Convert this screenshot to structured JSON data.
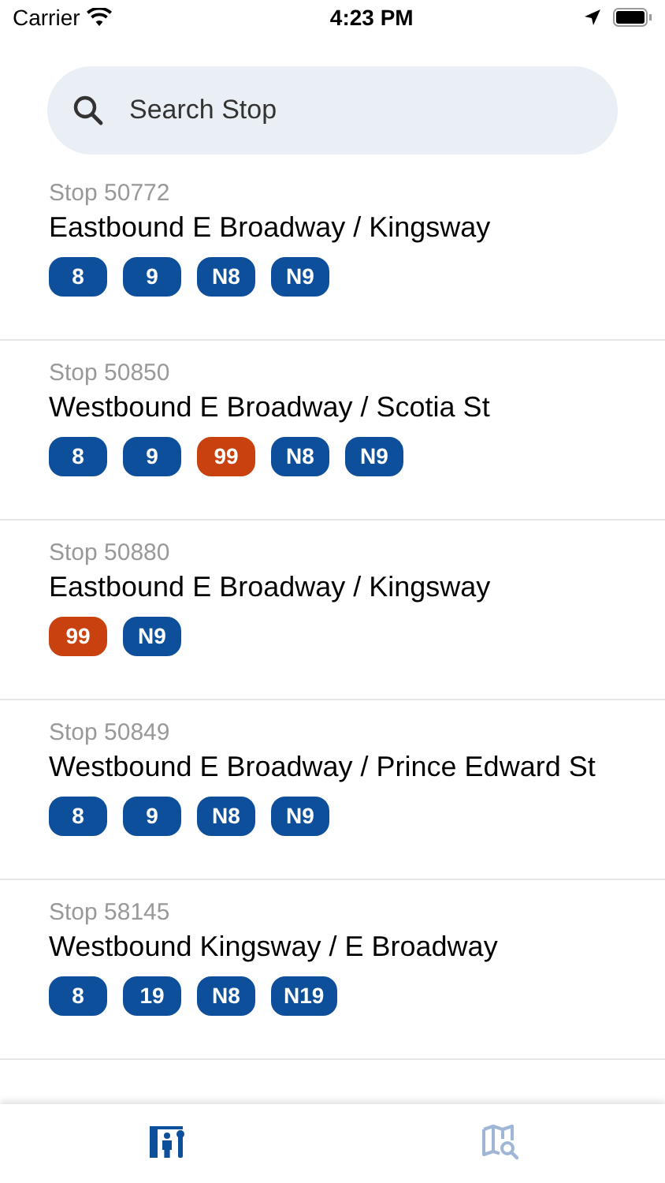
{
  "status_bar": {
    "carrier": "Carrier",
    "time": "4:23 PM"
  },
  "search": {
    "placeholder": "Search Stop"
  },
  "stops": [
    {
      "stop": "Stop 50772",
      "name": "Eastbound E Broadway / Kingsway",
      "routes": [
        {
          "label": "8",
          "color": "#0d4f9a"
        },
        {
          "label": "9",
          "color": "#0d4f9a"
        },
        {
          "label": "N8",
          "color": "#0d4f9a"
        },
        {
          "label": "N9",
          "color": "#0d4f9a"
        }
      ]
    },
    {
      "stop": "Stop 50850",
      "name": "Westbound E Broadway / Scotia St",
      "routes": [
        {
          "label": "8",
          "color": "#0d4f9a"
        },
        {
          "label": "9",
          "color": "#0d4f9a"
        },
        {
          "label": "99",
          "color": "#c8410f"
        },
        {
          "label": "N8",
          "color": "#0d4f9a"
        },
        {
          "label": "N9",
          "color": "#0d4f9a"
        }
      ]
    },
    {
      "stop": "Stop 50880",
      "name": "Eastbound E Broadway / Kingsway",
      "routes": [
        {
          "label": "99",
          "color": "#c8410f"
        },
        {
          "label": "N9",
          "color": "#0d4f9a"
        }
      ]
    },
    {
      "stop": "Stop 50849",
      "name": "Westbound E Broadway / Prince Edward St",
      "routes": [
        {
          "label": "8",
          "color": "#0d4f9a"
        },
        {
          "label": "9",
          "color": "#0d4f9a"
        },
        {
          "label": "N8",
          "color": "#0d4f9a"
        },
        {
          "label": "N9",
          "color": "#0d4f9a"
        }
      ]
    },
    {
      "stop": "Stop 58145",
      "name": "Westbound Kingsway / E Broadway",
      "routes": [
        {
          "label": "8",
          "color": "#0d4f9a"
        },
        {
          "label": "19",
          "color": "#0d4f9a"
        },
        {
          "label": "N8",
          "color": "#0d4f9a"
        },
        {
          "label": "N19",
          "color": "#0d4f9a"
        }
      ]
    }
  ],
  "tab_bar": [
    {
      "kind": "stops",
      "selected": true
    },
    {
      "kind": "map",
      "selected": false
    }
  ]
}
